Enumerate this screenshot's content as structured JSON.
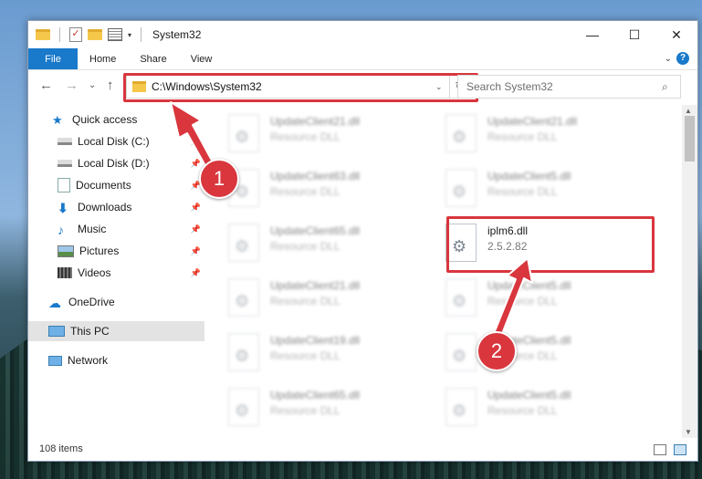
{
  "window": {
    "title": "System32"
  },
  "titlebar": {
    "minimize": "—",
    "maximize": "☐",
    "close": "✕",
    "quick_access_dropdown": "▾"
  },
  "ribbon": {
    "tabs": [
      "File",
      "Home",
      "Share",
      "View"
    ],
    "expand": "⌄",
    "help": "?"
  },
  "nav": {
    "back": "←",
    "forward": "→",
    "recent": "⌄",
    "up": "↑"
  },
  "address": {
    "path": "C:\\Windows\\System32",
    "dropdown": "⌄",
    "refresh": "↻"
  },
  "search": {
    "placeholder": "Search System32",
    "icon": "⌕"
  },
  "sidebar": {
    "items": [
      {
        "label": "Quick access",
        "icon": "star-icon"
      },
      {
        "label": "Local Disk (C:)",
        "icon": "drive-icon",
        "pinned": true
      },
      {
        "label": "Local Disk (D:)",
        "icon": "drive-icon",
        "pinned": true
      },
      {
        "label": "Documents",
        "icon": "documents-icon",
        "pinned": true
      },
      {
        "label": "Downloads",
        "icon": "download-icon",
        "pinned": true
      },
      {
        "label": "Music",
        "icon": "music-icon",
        "pinned": true
      },
      {
        "label": "Pictures",
        "icon": "pictures-icon",
        "pinned": true
      },
      {
        "label": "Videos",
        "icon": "videos-icon",
        "pinned": true
      },
      {
        "label": "OneDrive",
        "icon": "cloud-icon"
      },
      {
        "label": "This PC",
        "icon": "computer-icon",
        "selected": true
      },
      {
        "label": "Network",
        "icon": "network-icon"
      }
    ]
  },
  "files": [
    {
      "name": "UpdateClient21.dll",
      "sub": "Resource DLL"
    },
    {
      "name": "UpdateClient21.dll",
      "sub": "Resource DLL"
    },
    {
      "name": "UpdateClient63.dll",
      "sub": "Resource DLL"
    },
    {
      "name": "UpdateClient5.dll",
      "sub": "Resource DLL"
    },
    {
      "name": "UpdateClient65.dll",
      "sub": "Resource DLL"
    },
    {
      "name": "iplm6.dll",
      "sub": "2.5.2.82",
      "highlighted": true
    },
    {
      "name": "UpdateClient21.dll",
      "sub": "Resource DLL"
    },
    {
      "name": "UpdateClient5.dll",
      "sub": "Resource DLL"
    },
    {
      "name": "UpdateClient19.dll",
      "sub": "Resource DLL"
    },
    {
      "name": "UpdateClient5.dll",
      "sub": "Resource DLL"
    },
    {
      "name": "UpdateClient65.dll",
      "sub": "Resource DLL"
    },
    {
      "name": "UpdateClient5.dll",
      "sub": "Resource DLL"
    }
  ],
  "status": {
    "item_count": "108 items"
  },
  "annotations": {
    "step1": "1",
    "step2": "2",
    "color": "#d9363e"
  },
  "colors": {
    "accent": "#1979ca",
    "highlight_box": "#d9363e"
  }
}
